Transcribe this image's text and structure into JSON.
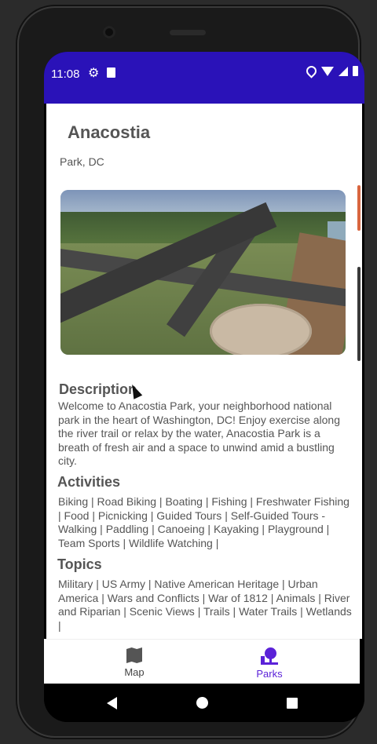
{
  "status": {
    "time": "11:08"
  },
  "park": {
    "name": "Anacostia",
    "subtitle": "Park, DC"
  },
  "description": {
    "heading": "Description",
    "text": "Welcome to Anacostia Park, your neighborhood national park in the heart of Washington, DC! Enjoy exercise along the river trail or relax by the water, Anacostia Park is a breath of fresh air and a space to unwind amid a bustling city."
  },
  "activities": {
    "heading": "Activities",
    "text": "Biking | Road Biking | Boating | Fishing | Freshwater Fishing | Food | Picnicking | Guided Tours | Self-Guided Tours - Walking | Paddling | Canoeing | Kayaking | Playground | Team Sports | Wildlife Watching |"
  },
  "topics": {
    "heading": "Topics",
    "text": "Military | US Army | Native American Heritage | Urban America | Wars and Conflicts | War of 1812 | Animals | River and Riparian | Scenic Views | Trails | Water Trails | Wetlands |"
  },
  "bottom_nav": {
    "map_label": "Map",
    "parks_label": "Parks"
  },
  "colors": {
    "status_bar": "#2a12b8",
    "accent": "#5b22d8"
  },
  "icons": [
    "gear-icon",
    "sd-card-icon",
    "location-icon",
    "wifi-icon",
    "signal-icon",
    "battery-icon",
    "map-icon",
    "park-icon",
    "back-icon",
    "home-icon",
    "recents-icon"
  ]
}
